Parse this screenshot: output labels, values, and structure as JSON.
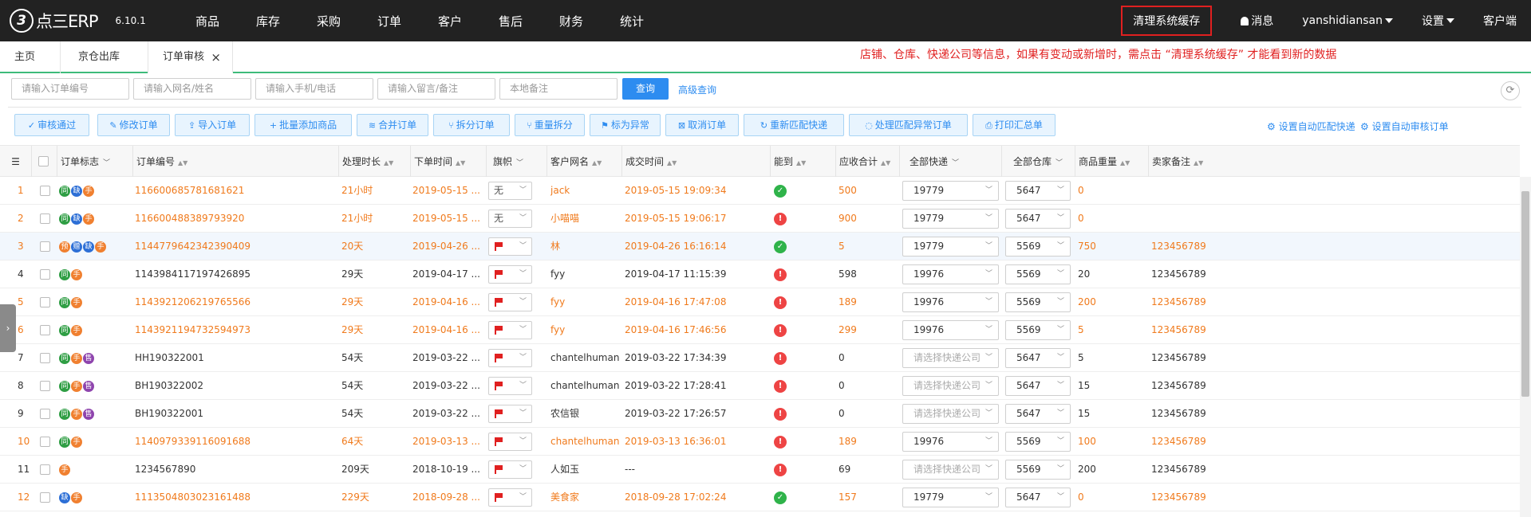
{
  "app": {
    "logo_glyph": "3",
    "logo_text": "点三ERP",
    "version": "6.10.1"
  },
  "nav": [
    "商品",
    "库存",
    "采购",
    "订单",
    "客户",
    "售后",
    "财务",
    "统计"
  ],
  "top_right": {
    "clear_cache": "清理系统缓存",
    "messages": "消息",
    "user": "yanshidiansan",
    "settings": "设置",
    "client": "客户端"
  },
  "tabs": [
    {
      "label": "主页"
    },
    {
      "label": "京仓出库"
    },
    {
      "label": "订单审核",
      "close": "×"
    }
  ],
  "notice": "店铺、仓库、快递公司等信息，如果有变动或新增时，需点击 “清理系统缓存” 才能看到新的数据",
  "filters": {
    "order_no": "请输入订单编号",
    "buyer": "请输入网名/姓名",
    "phone": "请输入手机/电话",
    "message": "请输入留言/备注",
    "local_note": "本地备注",
    "query": "查询",
    "advanced": "高级查询"
  },
  "actions": [
    {
      "icon": "✓",
      "label": "审核通过"
    },
    {
      "icon": "✎",
      "label": "修改订单"
    },
    {
      "icon": "⇪",
      "label": "导入订单"
    },
    {
      "icon": "+",
      "label": "批量添加商品"
    },
    {
      "icon": "≋",
      "label": "合并订单"
    },
    {
      "icon": "⑂",
      "label": "拆分订单"
    },
    {
      "icon": "⑂",
      "label": "重量拆分"
    },
    {
      "icon": "⚑",
      "label": "标为异常"
    },
    {
      "icon": "⊠",
      "label": "取消订单"
    },
    {
      "icon": "↻",
      "label": "重新匹配快递"
    },
    {
      "icon": "◌",
      "label": "处理匹配异常订单"
    },
    {
      "icon": "⎙",
      "label": "打印汇总单"
    }
  ],
  "right_links": {
    "auto_express": "设置自动匹配快递",
    "auto_audit": "设置自动审核订单"
  },
  "columns": {
    "flags": "订单标志",
    "order_no": "订单编号",
    "duration": "处理时长",
    "order_time": "下单时间",
    "flag": "旗帜",
    "buyer": "客户网名",
    "deal_time": "成交时间",
    "can": "能到",
    "receivable": "应收合计",
    "all_express": "全部快递",
    "all_warehouse": "全部仓库",
    "weight": "商品重量",
    "seller_note": "卖家备注"
  },
  "flag_none": "无",
  "express_placeholder": "请选择快递公司",
  "colors": {
    "topbar": "#222222",
    "accent": "#2d8cf0",
    "orange_text": "#f07a1c",
    "notice_red": "#e02020",
    "tab_underline": "#3dbb7a",
    "ok": "#2fb34a",
    "error": "#ee4444"
  },
  "rows": [
    {
      "no": "1",
      "orange": true,
      "badges": [
        [
          "同",
          "g"
        ],
        [
          "缺",
          "b"
        ],
        [
          "手",
          "o"
        ]
      ],
      "order_no": "116600685781681621",
      "duration": "21小时",
      "order_time": "2019-05-15 ...",
      "flag": "无",
      "buyer": "jack",
      "deal_time": "2019-05-15 19:09:34",
      "status": "ok",
      "receivable": "500",
      "express": "19779",
      "warehouse": "5647",
      "weight": "0",
      "note": ""
    },
    {
      "no": "2",
      "orange": true,
      "badges": [
        [
          "同",
          "g"
        ],
        [
          "缺",
          "b"
        ],
        [
          "手",
          "o"
        ]
      ],
      "order_no": "116600488389793920",
      "duration": "21小时",
      "order_time": "2019-05-15 ...",
      "flag": "无",
      "buyer": "小喵喵",
      "deal_time": "2019-05-15 19:06:17",
      "status": "err",
      "receivable": "900",
      "express": "19779",
      "warehouse": "5647",
      "weight": "0",
      "note": ""
    },
    {
      "no": "3",
      "orange": true,
      "hl": true,
      "badges": [
        [
          "预",
          "o"
        ],
        [
          "赠",
          "b"
        ],
        [
          "缺",
          "b"
        ],
        [
          "手",
          "o"
        ]
      ],
      "order_no": "1144779642342390409",
      "duration": "20天",
      "order_time": "2019-04-26 ...",
      "flag": "red",
      "buyer": "林",
      "deal_time": "2019-04-26 16:16:14",
      "status": "ok",
      "receivable": "5",
      "express": "19779",
      "warehouse": "5569",
      "weight": "750",
      "note": "123456789"
    },
    {
      "no": "4",
      "orange": false,
      "badges": [
        [
          "同",
          "g"
        ],
        [
          "手",
          "o"
        ]
      ],
      "order_no": "1143984117197426895",
      "duration": "29天",
      "order_time": "2019-04-17 ...",
      "flag": "red",
      "buyer": "fyy",
      "deal_time": "2019-04-17 11:15:39",
      "status": "err",
      "receivable": "598",
      "express": "19976",
      "warehouse": "5569",
      "weight": "20",
      "note": "123456789"
    },
    {
      "no": "5",
      "orange": true,
      "badges": [
        [
          "同",
          "g"
        ],
        [
          "手",
          "o"
        ]
      ],
      "order_no": "1143921206219765566",
      "duration": "29天",
      "order_time": "2019-04-16 ...",
      "flag": "red",
      "buyer": "fyy",
      "deal_time": "2019-04-16 17:47:08",
      "status": "err",
      "receivable": "189",
      "express": "19976",
      "warehouse": "5569",
      "weight": "200",
      "note": "123456789"
    },
    {
      "no": "6",
      "orange": true,
      "badges": [
        [
          "同",
          "g"
        ],
        [
          "手",
          "o"
        ]
      ],
      "order_no": "1143921194732594973",
      "duration": "29天",
      "order_time": "2019-04-16 ...",
      "flag": "red",
      "buyer": "fyy",
      "deal_time": "2019-04-16 17:46:56",
      "status": "err",
      "receivable": "299",
      "express": "19976",
      "warehouse": "5569",
      "weight": "5",
      "note": "123456789"
    },
    {
      "no": "7",
      "orange": false,
      "badges": [
        [
          "同",
          "g"
        ],
        [
          "手",
          "o"
        ],
        [
          "售",
          "p"
        ]
      ],
      "order_no": "HH190322001",
      "duration": "54天",
      "order_time": "2019-03-22 ...",
      "flag": "red",
      "buyer": "chantelhuman",
      "deal_time": "2019-03-22 17:34:39",
      "status": "err",
      "receivable": "0",
      "express": "",
      "warehouse": "5647",
      "weight": "5",
      "note": "123456789"
    },
    {
      "no": "8",
      "orange": false,
      "badges": [
        [
          "同",
          "g"
        ],
        [
          "手",
          "o"
        ],
        [
          "售",
          "p"
        ]
      ],
      "order_no": "BH190322002",
      "duration": "54天",
      "order_time": "2019-03-22 ...",
      "flag": "red",
      "buyer": "chantelhuman",
      "deal_time": "2019-03-22 17:28:41",
      "status": "err",
      "receivable": "0",
      "express": "",
      "warehouse": "5647",
      "weight": "15",
      "note": "123456789"
    },
    {
      "no": "9",
      "orange": false,
      "badges": [
        [
          "同",
          "g"
        ],
        [
          "手",
          "o"
        ],
        [
          "售",
          "p"
        ]
      ],
      "order_no": "BH190322001",
      "duration": "54天",
      "order_time": "2019-03-22 ...",
      "flag": "red",
      "buyer": "农信银",
      "deal_time": "2019-03-22 17:26:57",
      "status": "err",
      "receivable": "0",
      "express": "",
      "warehouse": "5647",
      "weight": "15",
      "note": "123456789"
    },
    {
      "no": "10",
      "orange": true,
      "badges": [
        [
          "同",
          "g"
        ],
        [
          "手",
          "o"
        ]
      ],
      "order_no": "1140979339116091688",
      "duration": "64天",
      "order_time": "2019-03-13 ...",
      "flag": "red",
      "buyer": "chantelhuman",
      "deal_time": "2019-03-13 16:36:01",
      "status": "err",
      "receivable": "189",
      "express": "19976",
      "warehouse": "5569",
      "weight": "100",
      "note": "123456789"
    },
    {
      "no": "11",
      "orange": false,
      "badges": [
        [
          "手",
          "o"
        ]
      ],
      "order_no": "1234567890",
      "duration": "209天",
      "order_time": "2018-10-19 ...",
      "flag": "red",
      "buyer": "人如玉",
      "deal_time": "---",
      "status": "err",
      "receivable": "69",
      "express": "",
      "warehouse": "5569",
      "weight": "200",
      "note": "123456789"
    },
    {
      "no": "12",
      "orange": true,
      "badges": [
        [
          "缺",
          "b"
        ],
        [
          "手",
          "o"
        ]
      ],
      "order_no": "1113504803023161488",
      "duration": "229天",
      "order_time": "2018-09-28 ...",
      "flag": "red",
      "buyer": "美食家",
      "deal_time": "2018-09-28 17:02:24",
      "status": "ok",
      "receivable": "157",
      "express": "19779",
      "warehouse": "5647",
      "weight": "0",
      "note": "123456789"
    }
  ]
}
